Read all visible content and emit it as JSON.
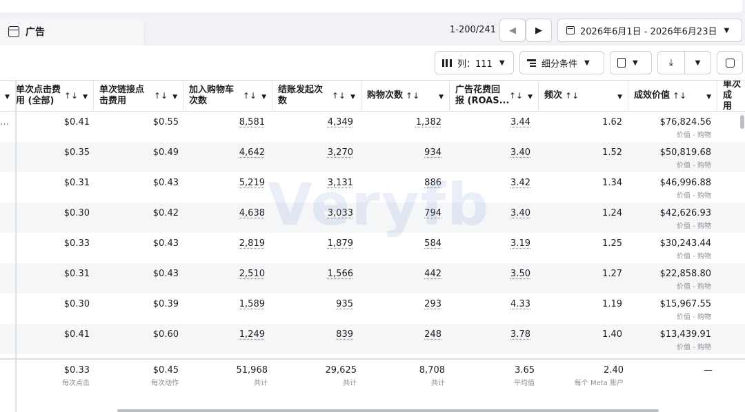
{
  "header": {
    "tab_label": "广告",
    "pagination": "1-200/241",
    "date_range": "2026年6月1日 - 2026年6月23日"
  },
  "toolbar": {
    "columns_label": "列：111",
    "breakdown_label": "细分条件"
  },
  "columns": [
    {
      "label": "单次点击费\n用 (全部)"
    },
    {
      "label": "单次链接点\n击费用"
    },
    {
      "label": "加入购物车\n次数"
    },
    {
      "label": "结账发起次\n数"
    },
    {
      "label": "购物次数"
    },
    {
      "label": "广告花费回\n报 (ROAS..."
    },
    {
      "label": "频次"
    },
    {
      "label": "成效价值"
    },
    {
      "label": "单次成\n用"
    }
  ],
  "sort_glyph": "↑↓",
  "caret_glyph": "▼",
  "ellipsis": "…",
  "rows": [
    {
      "cpc_all": "$0.41",
      "cpc_link": "$0.55",
      "add_to_cart": "8,581",
      "checkout": "4,349",
      "purchases": "1,382",
      "roas": "3.44",
      "frequency": "1.62",
      "value": "$76,824.56",
      "value_sub": "价值 - 购物"
    },
    {
      "cpc_all": "$0.35",
      "cpc_link": "$0.49",
      "add_to_cart": "4,642",
      "checkout": "3,270",
      "purchases": "934",
      "roas": "3.40",
      "frequency": "1.52",
      "value": "$50,819.68",
      "value_sub": "价值 - 购物"
    },
    {
      "cpc_all": "$0.31",
      "cpc_link": "$0.43",
      "add_to_cart": "5,219",
      "checkout": "3,131",
      "purchases": "886",
      "roas": "3.42",
      "frequency": "1.34",
      "value": "$46,996.88",
      "value_sub": "价值 - 购物"
    },
    {
      "cpc_all": "$0.30",
      "cpc_link": "$0.42",
      "add_to_cart": "4,638",
      "checkout": "3,033",
      "purchases": "794",
      "roas": "3.40",
      "frequency": "1.24",
      "value": "$42,626.93",
      "value_sub": "价值 - 购物"
    },
    {
      "cpc_all": "$0.33",
      "cpc_link": "$0.43",
      "add_to_cart": "2,819",
      "checkout": "1,879",
      "purchases": "584",
      "roas": "3.19",
      "frequency": "1.25",
      "value": "$30,243.44",
      "value_sub": "价值 - 购物"
    },
    {
      "cpc_all": "$0.31",
      "cpc_link": "$0.43",
      "add_to_cart": "2,510",
      "checkout": "1,566",
      "purchases": "442",
      "roas": "3.50",
      "frequency": "1.27",
      "value": "$22,858.80",
      "value_sub": "价值 - 购物"
    },
    {
      "cpc_all": "$0.30",
      "cpc_link": "$0.39",
      "add_to_cart": "1,589",
      "checkout": "935",
      "purchases": "293",
      "roas": "4.33",
      "frequency": "1.19",
      "value": "$15,967.55",
      "value_sub": "价值 - 购物"
    },
    {
      "cpc_all": "$0.41",
      "cpc_link": "$0.60",
      "add_to_cart": "1,249",
      "checkout": "839",
      "purchases": "248",
      "roas": "3.78",
      "frequency": "1.40",
      "value": "$13,439.91",
      "value_sub": "价值 - 购物"
    }
  ],
  "totals": {
    "cpc_all": "$0.33",
    "cpc_all_sub": "每次点击",
    "cpc_link": "$0.45",
    "cpc_link_sub": "每次动作",
    "add_to_cart": "51,968",
    "add_to_cart_sub": "共计",
    "checkout": "29,625",
    "checkout_sub": "共计",
    "purchases": "8,708",
    "purchases_sub": "共计",
    "roas": "3.65",
    "roas_sub": "平均值",
    "frequency": "2.40",
    "frequency_sub": "每个 Meta 账户",
    "value": "—"
  },
  "watermark": "Veryfb"
}
